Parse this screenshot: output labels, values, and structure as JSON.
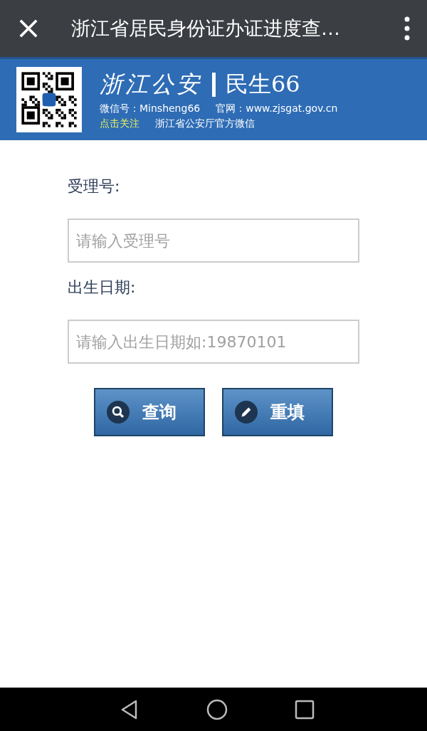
{
  "title_bar": {
    "title": "浙江省居民身份证办证进度查…"
  },
  "banner": {
    "logo": "浙江公安",
    "brand": "民生66",
    "wechat_id": "微信号：Minsheng66",
    "website": "官网：www.zjsgat.gov.cn",
    "follow": "点击关注",
    "subtitle": "浙江省公安厅官方微信"
  },
  "fields": [
    {
      "label": "受理号:",
      "placeholder": "请输入受理号"
    },
    {
      "label": "出生日期:",
      "placeholder": "请输入出生日期如:19870101"
    }
  ],
  "buttons": [
    {
      "kind": "search",
      "label": "查询"
    },
    {
      "kind": "edit",
      "label": "重填"
    }
  ]
}
